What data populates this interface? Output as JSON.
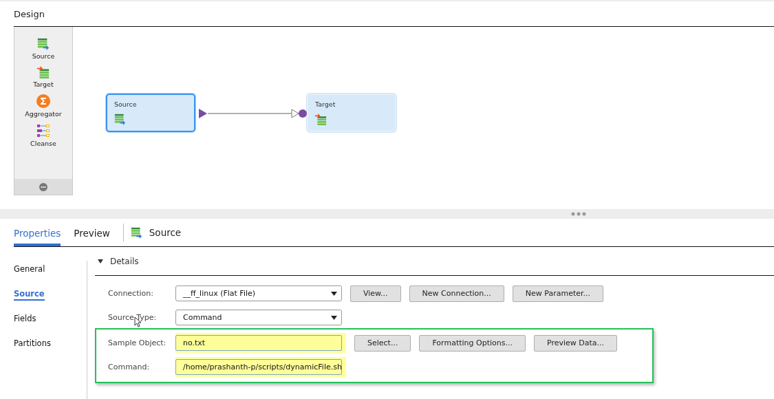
{
  "design": {
    "title": "Design",
    "palette": [
      {
        "kind": "source",
        "label": "Source"
      },
      {
        "kind": "target",
        "label": "Target"
      },
      {
        "kind": "aggregator",
        "label": "Aggregator"
      },
      {
        "kind": "cleanse",
        "label": "Cleanse"
      }
    ],
    "nodes": [
      {
        "kind": "source",
        "label": "Source",
        "selected": true
      },
      {
        "kind": "target",
        "label": "Target",
        "selected": false
      }
    ]
  },
  "properties": {
    "tabs": [
      {
        "label": "Properties",
        "selected": true
      },
      {
        "label": "Preview",
        "selected": false
      }
    ],
    "object": {
      "kind": "source",
      "label": "Source"
    },
    "nav": [
      {
        "label": "General",
        "selected": false
      },
      {
        "label": "Source",
        "selected": true
      },
      {
        "label": "Fields",
        "selected": false
      },
      {
        "label": "Partitions",
        "selected": false
      }
    ],
    "section": {
      "title": "Details",
      "expanded": true
    },
    "rows": [
      {
        "kind": "select",
        "label": "Connection:",
        "value": "__ff_linux (Flat File)",
        "highlighted": false,
        "buttons": [
          "View...",
          "New Connection...",
          "New Parameter..."
        ]
      },
      {
        "kind": "select",
        "label": "Source Type:",
        "value": "Command",
        "highlighted": false,
        "buttons": []
      },
      {
        "kind": "input",
        "label": "Sample Object:",
        "value": "no.txt",
        "highlighted": true,
        "buttons": [
          "Select...",
          "Formatting Options...",
          "Preview Data..."
        ]
      },
      {
        "kind": "input",
        "label": "Command:",
        "value": "/home/prashanth-p/scripts/dynamicFile.sh",
        "highlighted": true,
        "buttons": []
      }
    ]
  }
}
